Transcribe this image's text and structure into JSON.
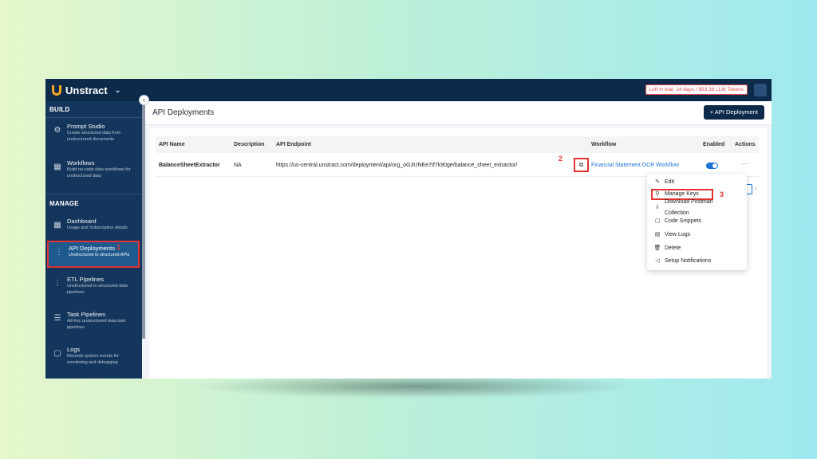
{
  "app": {
    "name": "Unstract",
    "trial_text": "Left in trial: 14 days / $93.38 LLM Tokens"
  },
  "sidebar": {
    "build_title": "BUILD",
    "manage_title": "MANAGE",
    "build_items": [
      {
        "title": "Prompt Studio",
        "desc": "Create structured data from unstructured documents",
        "icon": "prompt-studio-icon"
      },
      {
        "title": "Workflows",
        "desc": "Build no-code data workflows for unstructured data",
        "icon": "workflows-icon"
      }
    ],
    "manage_items": [
      {
        "title": "Dashboard",
        "desc": "Usage and Subscription details",
        "icon": "dashboard-icon"
      },
      {
        "title": "API Deployments",
        "desc": "Unstructured to structured APIs",
        "icon": "api-deployments-icon",
        "active": true
      },
      {
        "title": "ETL Pipelines",
        "desc": "Unstructured to structured data pipelines",
        "icon": "etl-pipelines-icon"
      },
      {
        "title": "Task Pipelines",
        "desc": "Ad-hoc unstructured data task pipelines",
        "icon": "task-pipelines-icon"
      },
      {
        "title": "Logs",
        "desc": "Records system events for monitoring and debugging",
        "icon": "logs-icon"
      }
    ]
  },
  "header": {
    "title": "API Deployments",
    "add_button": "+ API Deployment"
  },
  "table": {
    "columns": [
      "API Name",
      "Description",
      "API Endpoint",
      "Workflow",
      "Enabled",
      "Actions"
    ],
    "rows": [
      {
        "api_name": "BalanceSheetExtractor",
        "description": "NA",
        "endpoint": "https://us-central.unstract.com/deployment/api/org_oG3UNEe7If7k90ge/balance_sheet_extractor/",
        "workflow": "Financial Statement OCR Workflow",
        "enabled": true,
        "actions": "···"
      }
    ]
  },
  "actions_menu": {
    "items": [
      {
        "label": "Edit",
        "icon": "edit-icon"
      },
      {
        "label": "Manage Keys",
        "icon": "key-icon",
        "highlighted": true
      },
      {
        "label": "Download Postman Collection",
        "icon": "download-icon"
      },
      {
        "label": "Code Snippets",
        "icon": "code-icon"
      },
      {
        "label": "View Logs",
        "icon": "logs-icon"
      },
      {
        "label": "Delete",
        "icon": "delete-icon"
      },
      {
        "label": "Setup Notifications",
        "icon": "notification-icon"
      }
    ]
  },
  "annotations": {
    "step1": "1",
    "step2": "2",
    "step3": "3"
  },
  "colors": {
    "accent": "#1a73d9",
    "brand_dark": "#0d2a4a",
    "highlight_red": "#e33232"
  }
}
